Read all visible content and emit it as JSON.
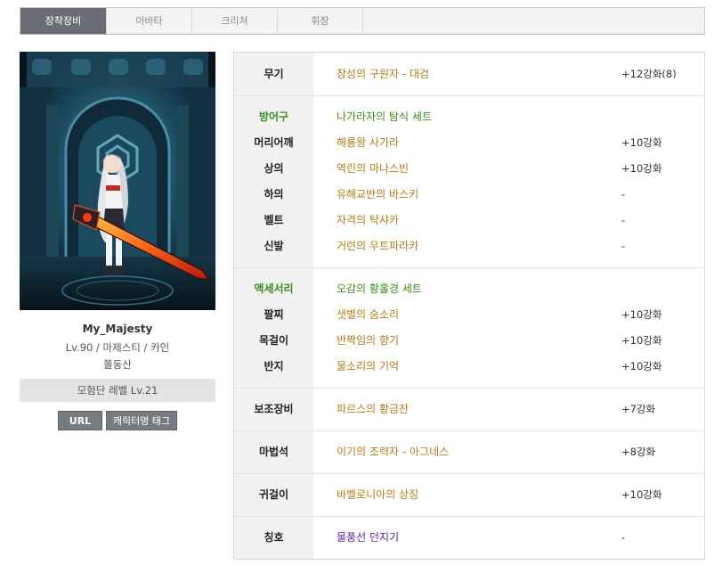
{
  "tabs": [
    {
      "label": "장착장비",
      "active": true
    },
    {
      "label": "아바타",
      "active": false
    },
    {
      "label": "크리쳐",
      "active": false
    },
    {
      "label": "휘장",
      "active": false
    }
  ],
  "character": {
    "name": "My_Majesty",
    "info": "Lv.90 / 마제스티 / 카인",
    "guild": "쫄동산",
    "adventure": "모험단 레벨 Lv.21",
    "url_button": "URL",
    "tag_button": "캐릭터명 태그"
  },
  "equipment": {
    "weapon": {
      "label": "무기",
      "name": "창성의 구원자 - 대검",
      "enhance": "+12강화(8)"
    },
    "armor": {
      "label": "방어구",
      "set": "나가라자의 탐식 세트",
      "items": [
        {
          "label": "머리어깨",
          "name": "해룡왕 사가라",
          "enhance": "+10강화"
        },
        {
          "label": "상의",
          "name": "역린의 마나스빈",
          "enhance": "+10강화"
        },
        {
          "label": "하의",
          "name": "유해교반의 바스키",
          "enhance": "-"
        },
        {
          "label": "벨트",
          "name": "자격의 탁샤카",
          "enhance": "-"
        },
        {
          "label": "신발",
          "name": "거련의 우트파라카",
          "enhance": "-"
        }
      ]
    },
    "accessory": {
      "label": "액세서리",
      "set": "오감의 황홀경 세트",
      "items": [
        {
          "label": "팔찌",
          "name": "샛별의 숨소리",
          "enhance": "+10강화"
        },
        {
          "label": "목걸이",
          "name": "반짝임의 향기",
          "enhance": "+10강화"
        },
        {
          "label": "반지",
          "name": "물소리의 기억",
          "enhance": "+10강화"
        }
      ]
    },
    "sub": {
      "label": "보조장비",
      "name": "파르스의 황금잔",
      "enhance": "+7강화"
    },
    "magicstone": {
      "label": "마법석",
      "name": "이기의 조력자 - 아그네스",
      "enhance": "+8강화"
    },
    "earring": {
      "label": "귀걸이",
      "name": "바벨로니아의 상징",
      "enhance": "+10강화"
    },
    "title": {
      "label": "칭호",
      "name": "물풍선 던지기",
      "enhance": "-"
    }
  },
  "colors": {
    "item_name": "#b07c18",
    "set_name": "#3a8d1c",
    "title_name": "#5a1fa0",
    "active_tab": "#6a6e74"
  }
}
